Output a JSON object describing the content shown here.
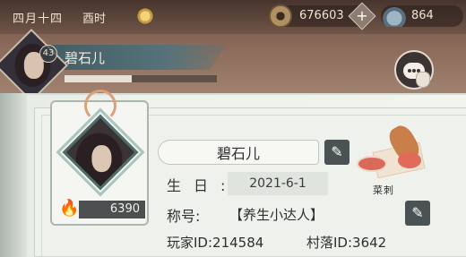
{
  "top_bar": {
    "date": "四月十四",
    "shichen": "酉时",
    "copper_coins": "676603",
    "silver_ingots": "864",
    "add_symbol": "+"
  },
  "player_header": {
    "level": "43",
    "name": "碧石儿",
    "experience_progress": 0.44
  },
  "chat": {
    "icon": "chat-bubble-icon"
  },
  "profile_card": {
    "power": "6390",
    "flame_icon": "flame-icon"
  },
  "profile": {
    "name": "碧石儿",
    "birthday_label": "生日:",
    "birthday_value": "2021-6-1",
    "title_label": "称号:",
    "title_value": "【养生小达人】",
    "player_id_text": "玩家ID:214584",
    "village_id_text": "村落ID:3642",
    "edit_icon": "pencil-icon"
  },
  "decoration": {
    "food_label": "菜刺"
  },
  "colors": {
    "header_bar": "#55727a",
    "edit_button": "#4a5254",
    "panel_bg": "#eef1ec",
    "flame": "#f2a93a"
  }
}
